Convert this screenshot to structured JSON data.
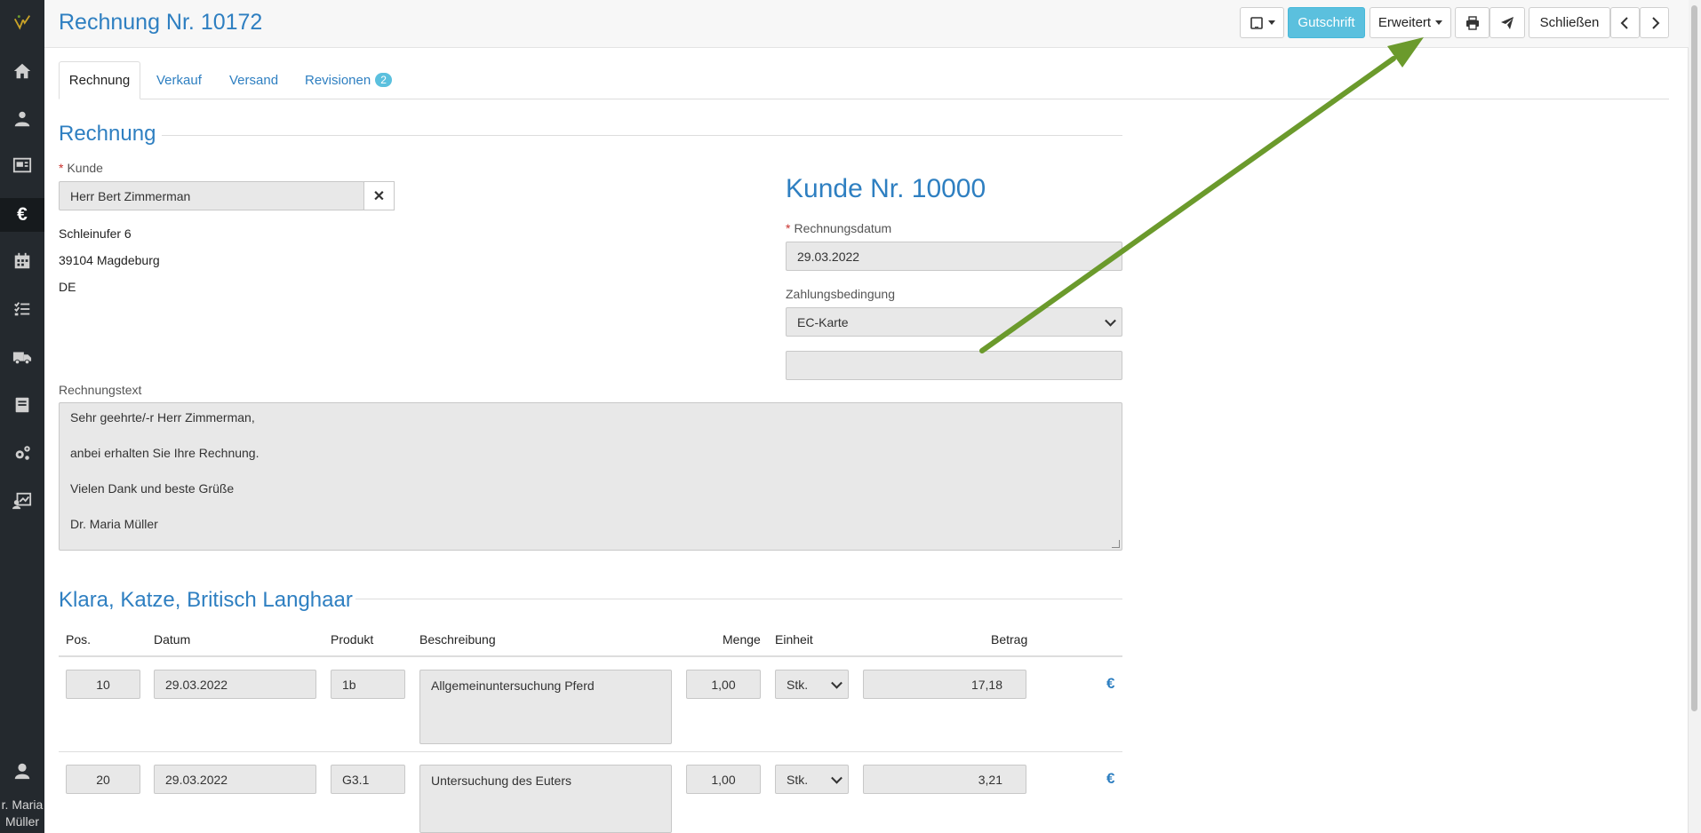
{
  "page": {
    "title": "Rechnung Nr. 10172"
  },
  "toolbar": {
    "credit_label": "Gutschrift",
    "advanced_label": "Erweitert",
    "close_label": "Schließen",
    "accent_color": "#5bc0de"
  },
  "tabs": [
    {
      "label": "Rechnung",
      "active": true
    },
    {
      "label": "Verkauf"
    },
    {
      "label": "Versand"
    },
    {
      "label": "Revisionen",
      "badge": "2"
    }
  ],
  "sidebar": {
    "icons": [
      "logo-icon",
      "home-icon",
      "customers-icon",
      "media-icon",
      "invoice-euro-icon",
      "calendar-icon",
      "tasks-icon",
      "shipping-truck-icon",
      "book-icon",
      "settings-gears-icon",
      "reports-icon"
    ],
    "user_name_line1": "r. Maria",
    "user_name_line2": "Müller"
  },
  "invoice": {
    "section_title": "Rechnung",
    "customer_label": "Kunde",
    "customer_value": "Herr Bert Zimmerman",
    "address": [
      "Schleinufer 6",
      "39104 Magdeburg",
      "DE"
    ],
    "customer_number_title": "Kunde Nr. 10000",
    "date_label": "Rechnungsdatum",
    "date_value": "29.03.2022",
    "payment_terms_label": "Zahlungsbedingung",
    "payment_terms_value": "EC-Karte",
    "extra_field_value": "",
    "text_label": "Rechnungstext",
    "text_lines": [
      "Sehr geehrte/-r Herr Zimmerman,",
      "anbei erhalten Sie Ihre Rechnung.",
      "Vielen Dank und beste Grüße",
      "Dr. Maria Müller"
    ]
  },
  "patient": {
    "title": "Klara, Katze, Britisch Langhaar",
    "columns": [
      "Pos.",
      "Datum",
      "Produkt",
      "Beschreibung",
      "Menge",
      "Einheit",
      "Betrag"
    ],
    "rows": [
      {
        "pos": "10",
        "date": "29.03.2022",
        "product": "1b",
        "description": "Allgemeinuntersuchung Pferd",
        "qty": "1,00",
        "unit": "Stk.",
        "amount": "17,18",
        "currency": "€"
      },
      {
        "pos": "20",
        "date": "29.03.2022",
        "product": "G3.1",
        "description": "Untersuchung des Euters",
        "qty": "1,00",
        "unit": "Stk.",
        "amount": "3,21",
        "currency": "€"
      }
    ]
  },
  "annotation": {
    "arrow_color": "#6b9a2c",
    "points_to": "Erweitert"
  }
}
